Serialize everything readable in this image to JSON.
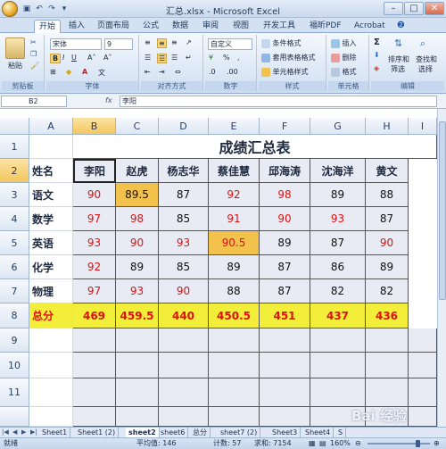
{
  "window": {
    "title": "汇总.xlsx - Microsoft Excel",
    "min": "–",
    "max": "□",
    "close": "✕"
  },
  "tabs": [
    "开始",
    "插入",
    "页面布局",
    "公式",
    "数据",
    "审阅",
    "视图",
    "开发工具",
    "福昕PDF",
    "Acrobat"
  ],
  "ribbon": {
    "paste": "粘贴",
    "clipboard": "剪贴板",
    "font_name": "宋体",
    "font_size": "9",
    "font_group": "字体",
    "align_group": "对齐方式",
    "number_format": "自定义",
    "number_group": "数字",
    "cond_format": "条件格式",
    "table_format": "套用表格格式",
    "cell_style": "单元格样式",
    "style_group": "样式",
    "insert": "插入",
    "delete": "删除",
    "format": "格式",
    "cells_group": "单元格",
    "sort_filter": "排序和\n筛选",
    "sort_filter_line1": "排序和",
    "sort_filter_line2": "筛选",
    "find_select_line1": "查找和",
    "find_select_line2": "选择",
    "edit_group": "编辑"
  },
  "formula_bar": {
    "name_box": "B2",
    "fx": "fx",
    "value": "李阳"
  },
  "columns": [
    "A",
    "B",
    "C",
    "D",
    "E",
    "F",
    "G",
    "H",
    "I"
  ],
  "rows": [
    "1",
    "2",
    "3",
    "4",
    "5",
    "6",
    "7",
    "8",
    "9",
    "10",
    "11"
  ],
  "sheet": {
    "title": "成绩汇总表",
    "headers": [
      "姓名",
      "李阳",
      "赵虎",
      "杨志华",
      "蔡佳慧",
      "邱海涛",
      "沈海洋",
      "黄文"
    ],
    "subjects": [
      "语文",
      "数学",
      "英语",
      "化学",
      "物理"
    ],
    "scores": [
      [
        "90",
        "89.5",
        "87",
        "92",
        "98",
        "89",
        "88"
      ],
      [
        "97",
        "98",
        "85",
        "91",
        "90",
        "93",
        "87"
      ],
      [
        "93",
        "90",
        "93",
        "90.5",
        "89",
        "87",
        "90"
      ],
      [
        "92",
        "89",
        "85",
        "89",
        "87",
        "86",
        "89"
      ],
      [
        "97",
        "93",
        "90",
        "88",
        "87",
        "82",
        "82"
      ]
    ],
    "total_label": "总分",
    "totals": [
      "469",
      "459.5",
      "440",
      "450.5",
      "451",
      "437",
      "436"
    ]
  },
  "sheet_tabs": [
    "Sheet1",
    "Sheet1 (2)",
    "sheet2",
    "sheet6",
    "总分",
    "sheet7 (2)",
    "Sheet3",
    "Sheet4",
    "S"
  ],
  "active_sheet": "sheet2",
  "status": {
    "ready": "就绪",
    "average": "平均值: 146",
    "count": "计数: 57",
    "sum": "求和: 7154",
    "zoom": "160%"
  },
  "watermark": "Bai 经验",
  "colors": {
    "red_text": "#e01010",
    "orange_hl": "#f2c24c",
    "yellow_hl": "#f2ee3a",
    "table_bg": "#e8ebf3"
  }
}
